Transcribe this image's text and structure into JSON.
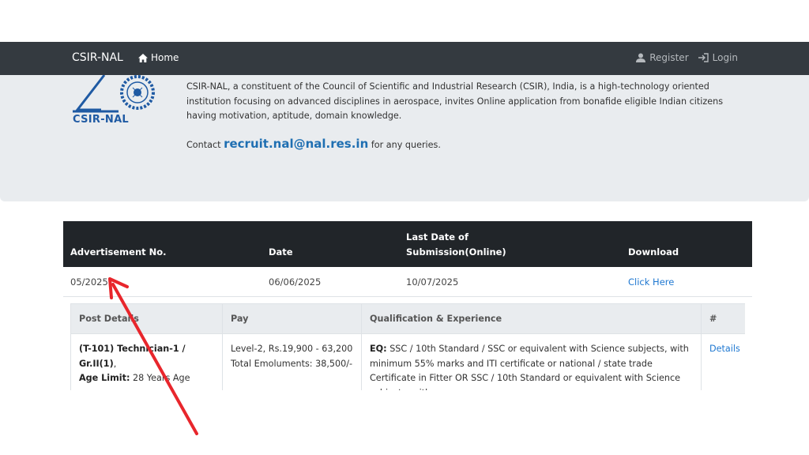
{
  "navbar": {
    "brand": "CSIR-NAL",
    "home": "Home",
    "register": "Register",
    "login": "Login"
  },
  "hero": {
    "logo_text": "CSIR-NAL",
    "intro": "CSIR-NAL, a constituent of the Council of Scientific and Industrial Research (CSIR), India, is a high-technology oriented institution focusing on advanced disciplines in aerospace, invites Online application from bonafide eligible Indian citizens having motivation, aptitude, domain knowledge.",
    "contact_prefix": "Contact",
    "contact_email": "recruit.nal@nal.res.in",
    "contact_suffix": "for any queries."
  },
  "adv_table": {
    "headers": {
      "adv_no": "Advertisement No.",
      "date": "Date",
      "last_date_line1": "Last Date of",
      "last_date_line2": "Submission(Online)",
      "download": "Download"
    },
    "row": {
      "adv_no": "05/2025",
      "date": "06/06/2025",
      "last_date": "10/07/2025",
      "download": "Click Here"
    }
  },
  "posts_table": {
    "headers": {
      "post": "Post Details",
      "pay": "Pay",
      "qual": "Qualification & Experience",
      "hash": "#"
    },
    "row": {
      "post_title": "(T-101) Technician-1 / Gr.II(1)",
      "post_suffix": ",",
      "age_label": "Age Limit:",
      "age_value": "28 Years Age",
      "pay_line1": "Level-2, Rs.19,900 - 63,200",
      "pay_line2": "Total Emoluments: 38,500/-",
      "qual_label": "EQ:",
      "qual_text": "SSC / 10th Standard / SSC or equivalent with Science subjects, with minimum 55% marks and ITI certificate or national / state trade Certificate in Fitter OR SSC / 10th Standard or equivalent with Science subjects, with",
      "details": "Details"
    }
  },
  "annotation": {
    "color": "#e8262c"
  }
}
